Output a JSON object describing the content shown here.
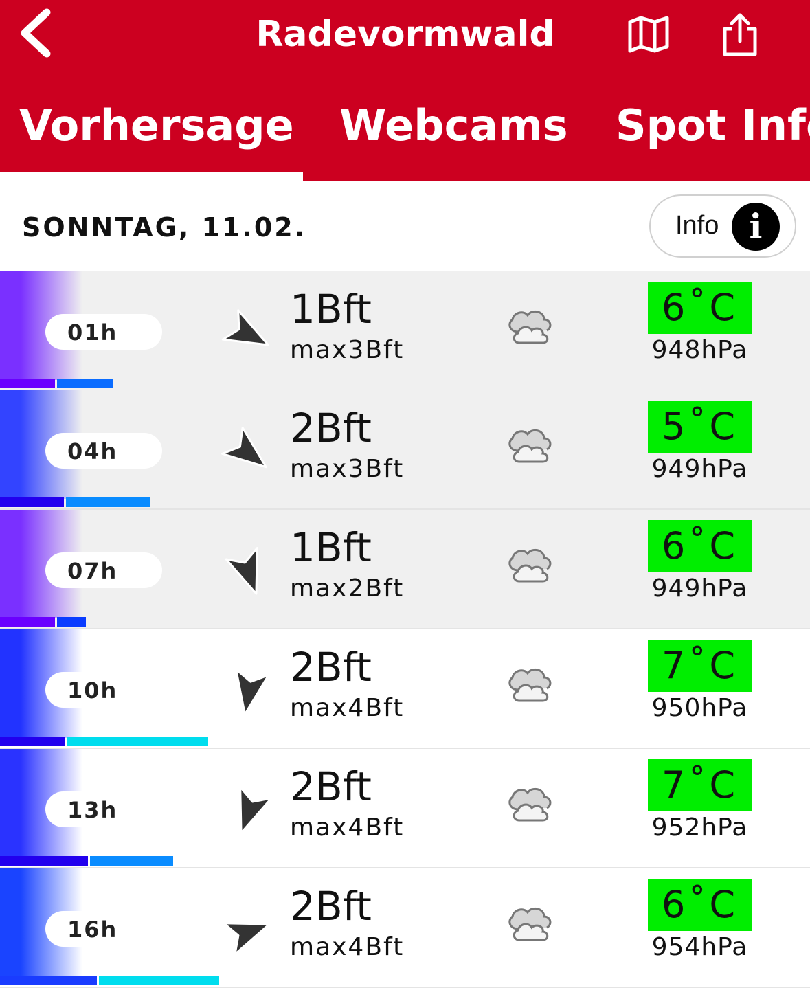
{
  "header": {
    "title": "Radevormwald",
    "back_icon": "chevron-left-icon",
    "map_icon": "map-icon",
    "share_icon": "share-icon"
  },
  "tabs": [
    {
      "label": "Vorhersage",
      "active": true
    },
    {
      "label": "Webcams"
    },
    {
      "label": "Spot Info"
    }
  ],
  "day": {
    "title": "SONNTAG, 11.02.",
    "info_label": "Info",
    "info_glyph": "i"
  },
  "colors": {
    "brand": "#cc0020",
    "temp_bg": "#00ee00"
  },
  "rows": [
    {
      "hour": "01h",
      "wind": "1Bft",
      "gust": "max3Bft",
      "temp": "6˚C",
      "pressure": "948hPa",
      "direction_deg": 118,
      "weather_icon": "cloud-icon",
      "bar1": 80,
      "bar2": 82,
      "c1": "#6a00ff",
      "c2": "#0a6cff",
      "grad": "#7a30ff"
    },
    {
      "hour": "04h",
      "wind": "2Bft",
      "gust": "max3Bft",
      "temp": "5˚C",
      "pressure": "949hPa",
      "direction_deg": 128,
      "weather_icon": "cloud-icon",
      "bar1": 93,
      "bar2": 123,
      "c1": "#2200ee",
      "c2": "#0a8cff",
      "grad": "#3344ff"
    },
    {
      "hour": "07h",
      "wind": "1Bft",
      "gust": "max2Bft",
      "temp": "6˚C",
      "pressure": "949hPa",
      "direction_deg": 160,
      "weather_icon": "cloud-icon",
      "bar1": 80,
      "bar2": 42,
      "c1": "#6a00ff",
      "c2": "#0a3cff",
      "grad": "#7a30ff"
    },
    {
      "hour": "10h",
      "wind": "2Bft",
      "gust": "max4Bft",
      "temp": "7˚C",
      "pressure": "950hPa",
      "direction_deg": 190,
      "weather_icon": "cloud-icon",
      "bar1": 95,
      "bar2": 205,
      "c1": "#2200ee",
      "c2": "#00ddee",
      "grad": "#2233ff"
    },
    {
      "hour": "13h",
      "wind": "2Bft",
      "gust": "max4Bft",
      "temp": "7˚C",
      "pressure": "952hPa",
      "direction_deg": 200,
      "weather_icon": "cloud-icon",
      "bar1": 128,
      "bar2": 121,
      "c1": "#2200ee",
      "c2": "#0a8cff",
      "grad": "#2a33ff"
    },
    {
      "hour": "16h",
      "wind": "2Bft",
      "gust": "max4Bft",
      "temp": "6˚C",
      "pressure": "954hPa",
      "direction_deg": 70,
      "weather_icon": "cloud-icon",
      "bar1": 141,
      "bar2": 175,
      "c1": "#1a3cff",
      "c2": "#00ddee",
      "grad": "#1a44ff"
    }
  ]
}
